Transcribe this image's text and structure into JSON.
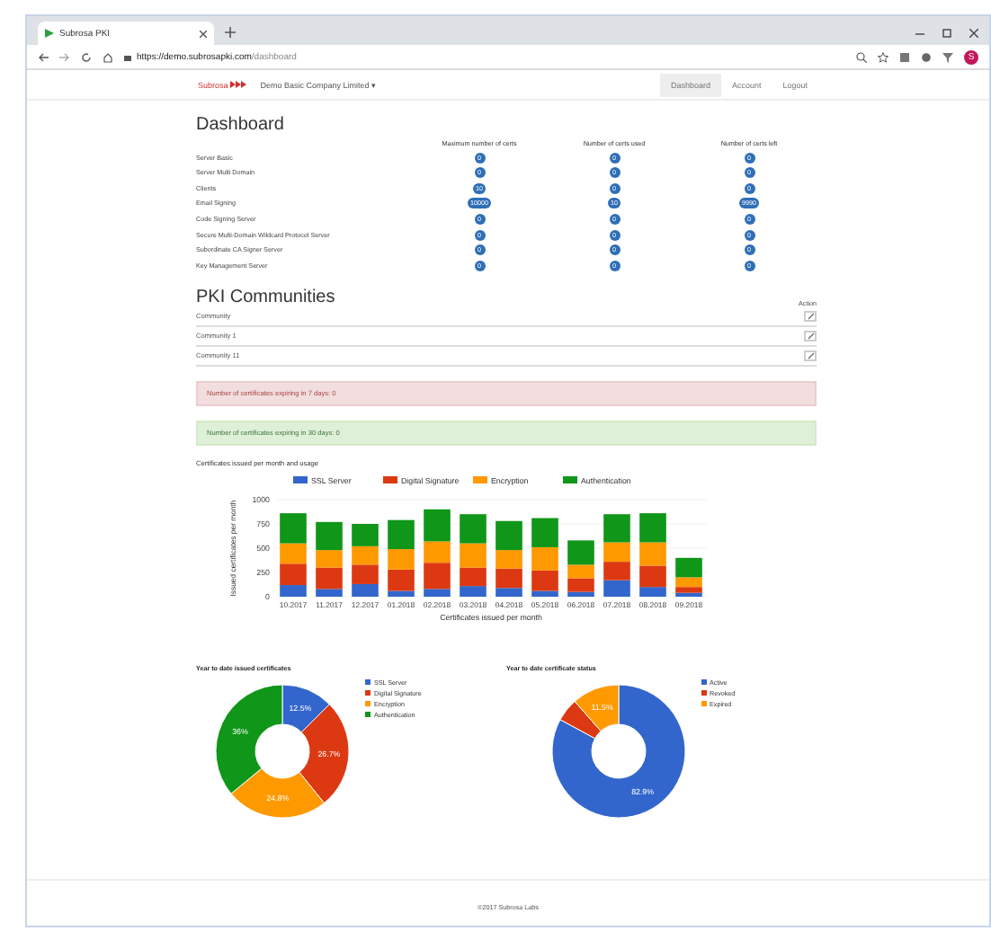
{
  "browser": {
    "tab_title": "Subrosa PKI",
    "url_host": "https://demo.subrosapki.com",
    "url_path": "/dashboard",
    "profile_initial": "S"
  },
  "navbar": {
    "brand": "Subrosa",
    "company": "Demo Basic Company Limited",
    "company_caret": "▾",
    "links": [
      {
        "label": "Dashboard",
        "selected": true
      },
      {
        "label": "Account",
        "selected": false
      },
      {
        "label": "Logout",
        "selected": false
      }
    ]
  },
  "dashboard": {
    "title": "Dashboard",
    "columns": [
      "Maximum number of certs",
      "Number of certs used",
      "Number of certs left"
    ],
    "rows": [
      {
        "name": "Server Basic",
        "values": [
          "0",
          "0",
          "0"
        ]
      },
      {
        "name": "Server Multi Domain",
        "values": [
          "0",
          "0",
          "0"
        ]
      },
      {
        "name": "Clients",
        "values": [
          "10",
          "0",
          "0"
        ]
      },
      {
        "name": "Email Signing",
        "values": [
          "10000",
          "10",
          "9990"
        ]
      },
      {
        "name": "Code Signing Server",
        "values": [
          "0",
          "0",
          "0"
        ]
      },
      {
        "name": "Secure Multi-Domain Wildcard Protocol Server",
        "values": [
          "0",
          "0",
          "0"
        ]
      },
      {
        "name": "Subordinate CA Signer Server",
        "values": [
          "0",
          "0",
          "0"
        ]
      },
      {
        "name": "Key Management Server",
        "values": [
          "0",
          "0",
          "0"
        ]
      }
    ]
  },
  "communities": {
    "title": "PKI Communities",
    "action_header": "Action",
    "rows": [
      "Community",
      "Community 1",
      "Community 11"
    ]
  },
  "alerts": [
    {
      "kind": "danger",
      "text": "Number of certificates expiring in 7 days: 0"
    },
    {
      "kind": "success",
      "text": "Number of certificates expiring in 30 days: 0"
    }
  ],
  "monthly": {
    "subtitle": "Certificates issued per month and usage",
    "chart_data": {
      "type": "bar",
      "stacked": true,
      "xlabel": "Certificates issued per month",
      "ylabel": "Issued certificates per month",
      "categories": [
        "10.2017",
        "11.2017",
        "12.2017",
        "01.2018",
        "02.2018",
        "03.2018",
        "04.2018",
        "05.2018",
        "06.2018",
        "07.2018",
        "08.2018",
        "09.2018"
      ],
      "yticks": [
        0,
        250,
        500,
        750,
        1000
      ],
      "ylim": [
        0,
        1000
      ],
      "grid": true,
      "legend": "top",
      "series": [
        {
          "name": "SSL Server",
          "color": "#3366cc",
          "values": [
            120,
            80,
            130,
            60,
            80,
            110,
            90,
            60,
            50,
            170,
            100,
            40
          ]
        },
        {
          "name": "Digital Signature",
          "color": "#dc3912",
          "values": [
            220,
            220,
            200,
            220,
            270,
            190,
            200,
            210,
            140,
            190,
            220,
            60
          ]
        },
        {
          "name": "Encryption",
          "color": "#ff9900",
          "values": [
            210,
            180,
            190,
            210,
            220,
            250,
            190,
            240,
            140,
            200,
            240,
            100
          ]
        },
        {
          "name": "Authentication",
          "color": "#109618",
          "values": [
            310,
            290,
            230,
            300,
            330,
            300,
            300,
            300,
            250,
            290,
            300,
            200
          ]
        }
      ]
    }
  },
  "donuts": [
    {
      "chart_data": {
        "type": "donut",
        "title": "Year to date issued certificates",
        "categories": [
          "SSL Server",
          "Digital Signature",
          "Encryption",
          "Authentication"
        ],
        "values": [
          12.5,
          26.7,
          24.8,
          36
        ],
        "value_labels": [
          "12.5%",
          "26.7%",
          "24.8%",
          "36%"
        ]
      }
    },
    {
      "chart_data": {
        "type": "donut",
        "title": "Year to date certificate status",
        "categories": [
          "Active",
          "Revoked",
          "Expired"
        ],
        "values": [
          82.9,
          5.6,
          11.5
        ],
        "value_labels": [
          "82.9%",
          null,
          "11.5%"
        ]
      }
    }
  ],
  "footer": "©2017 Subrosa Labs"
}
